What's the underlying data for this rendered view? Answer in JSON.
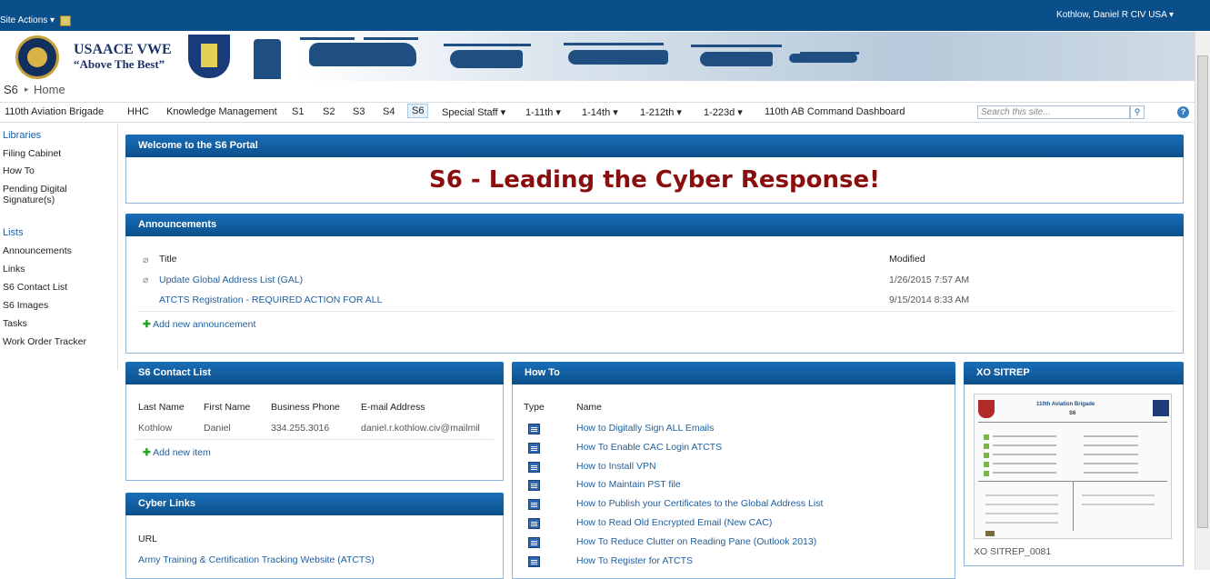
{
  "topbar": {
    "site_actions": "Site Actions ▾",
    "user": "Kothlow, Daniel R CIV USA ▾"
  },
  "banner": {
    "title": "USAACE VWE",
    "motto": "“Above The Best”"
  },
  "breadcrumb": {
    "site": "S6",
    "page": "Home"
  },
  "nav": {
    "items": [
      "110th Aviation Brigade",
      "HHC",
      "Knowledge Management",
      "S1",
      "S2",
      "S3",
      "S4",
      "S6",
      "Special Staff ▾",
      "1-11th ▾",
      "1-14th ▾",
      "1-212th ▾",
      "1-223d ▾",
      "110th AB Command Dashboard"
    ],
    "search_placeholder": "Search this site..."
  },
  "quicklaunch": {
    "libraries": "Libraries",
    "lib_items": [
      "Filing Cabinet",
      "How To",
      "Pending Digital Signature(s)"
    ],
    "lists": "Lists",
    "list_items": [
      "Announcements",
      "Links",
      "S6 Contact List",
      "S6 Images",
      "Tasks",
      "Work Order Tracker"
    ]
  },
  "welcome": {
    "title": "Welcome to the S6 Portal",
    "heading": "S6 - Leading the Cyber Response!"
  },
  "announcements": {
    "title": "Announcements",
    "col_title": "Title",
    "col_modified": "Modified",
    "rows": [
      {
        "title": "Update Global Address List (GAL)",
        "modified": "1/26/2015 7:57 AM"
      },
      {
        "title": "ATCTS Registration - REQUIRED ACTION FOR ALL",
        "modified": "9/15/2014 8:33 AM"
      }
    ],
    "add": "Add new announcement"
  },
  "contacts": {
    "title": "S6 Contact List",
    "cols": [
      "Last Name",
      "First Name",
      "Business Phone",
      "E-mail Address"
    ],
    "row": [
      "Kothlow",
      "Daniel",
      "334.255.3016",
      "daniel.r.kothlow.civ@mailmil"
    ],
    "add": "Add new item"
  },
  "cyber": {
    "title": "Cyber Links",
    "col": "URL",
    "link": "Army Training & Certification Tracking Website (ATCTS)"
  },
  "howto": {
    "title": "How To",
    "col_type": "Type",
    "col_name": "Name",
    "items": [
      "How to Digitally Sign ALL Emails",
      "How To Enable CAC Login ATCTS",
      "How to Install VPN",
      "How to Maintain PST file",
      "How to Publish your Certificates to the Global Address List",
      "How to Read Old Encrypted Email (New CAC)",
      "How To Reduce Clutter on Reading Pane (Outlook 2013)",
      "How To Register for ATCTS"
    ]
  },
  "sitrep": {
    "title": "XO SITREP",
    "brigade": "110th Aviation Brigade",
    "unit": "S6",
    "caption": "XO SITREP_0081"
  }
}
